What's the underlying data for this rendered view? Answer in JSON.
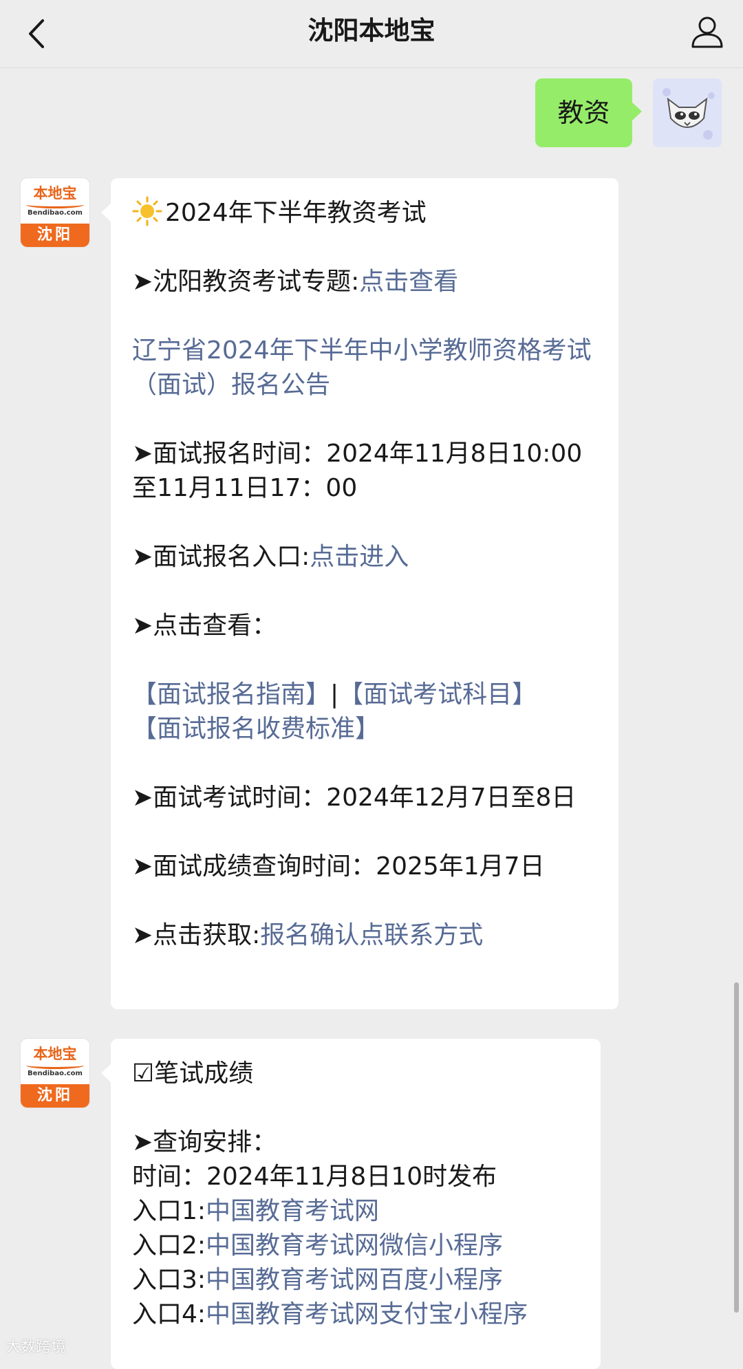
{
  "header": {
    "title": "沈阳本地宝"
  },
  "outgoing": {
    "text": "教资"
  },
  "account_avatar": {
    "logo": "本地宝",
    "domain": "Bendibao.com",
    "city": "沈阳"
  },
  "message1": {
    "title": "2024年下半年教资考试",
    "topic_label": "➤沈阳教资考试专题:",
    "topic_link": "点击查看",
    "announcement_link": "辽宁省2024年下半年中小学教师资格考试（面试）报名公告",
    "signup_time": "➤面试报名时间：2024年11月8日10:00至11月11日17：00",
    "signup_entry_label": "➤面试报名入口:",
    "signup_entry_link": "点击进入",
    "view_label": "➤点击查看：",
    "guide_link": "【面试报名指南】",
    "separator": "|",
    "subjects_link": "【面试考试科目】",
    "fee_link": "【面试报名收费标准】",
    "exam_time": "➤面试考试时间：2024年12月7日至8日",
    "score_time": "➤面试成绩查询时间：2025年1月7日",
    "contact_label": "➤点击获取:",
    "contact_link": "报名确认点联系方式"
  },
  "message2": {
    "title": "☑笔试成绩",
    "query_label": "➤查询安排：",
    "time_line": "时间：2024年11月8日10时发布",
    "entries": [
      {
        "label": "入口1:",
        "link": "中国教育考试网"
      },
      {
        "label": "入口2:",
        "link": "中国教育考试网微信小程序"
      },
      {
        "label": "入口3:",
        "link": "中国教育考试网百度小程序"
      },
      {
        "label": "入口4:",
        "link": "中国教育考试网支付宝小程序"
      }
    ]
  },
  "watermark": "大数跨境",
  "colors": {
    "background": "#ededed",
    "outgoing_bubble": "#95ec69",
    "link": "#576b95",
    "brand_orange": "#ef6a1e"
  },
  "icons": [
    "back-arrow-icon",
    "profile-icon",
    "sun-icon"
  ]
}
